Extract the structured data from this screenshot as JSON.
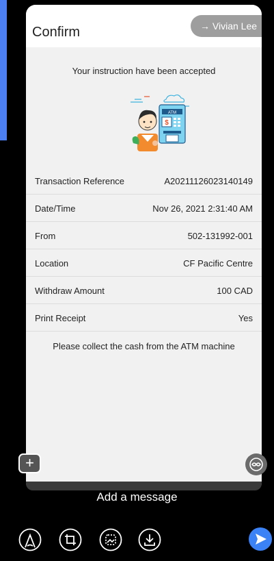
{
  "header": {
    "title": "Confirm",
    "recipient": "→ Vivian Lee"
  },
  "message": {
    "accepted": "Your instruction have been accepted",
    "collect": "Please collect the cash from the ATM machine"
  },
  "illustration": {
    "atm_text": "ATM",
    "dollar": "$"
  },
  "details": [
    {
      "label": "Transaction Reference",
      "value": "A20211126023140149"
    },
    {
      "label": "Date/Time",
      "value": "Nov 26, 2021 2:31:40 AM"
    },
    {
      "label": "From",
      "value": "502-131992-001"
    },
    {
      "label": "Location",
      "value": "CF Pacific Centre"
    },
    {
      "label": "Withdraw Amount",
      "value": "100 CAD"
    },
    {
      "label": "Print Receipt",
      "value": "Yes"
    }
  ],
  "composer": {
    "add_message": "Add a message",
    "plus": "+"
  },
  "icons": {
    "pen": "pen-icon",
    "crop": "crop-rotate-icon",
    "sticker": "sticker-icon",
    "download": "download-icon",
    "send": "send-icon",
    "loop": "loop-icon"
  },
  "colors": {
    "accent": "#3b82f6",
    "background_blue": "#4b7ff2",
    "card": "#f1f1f1"
  }
}
